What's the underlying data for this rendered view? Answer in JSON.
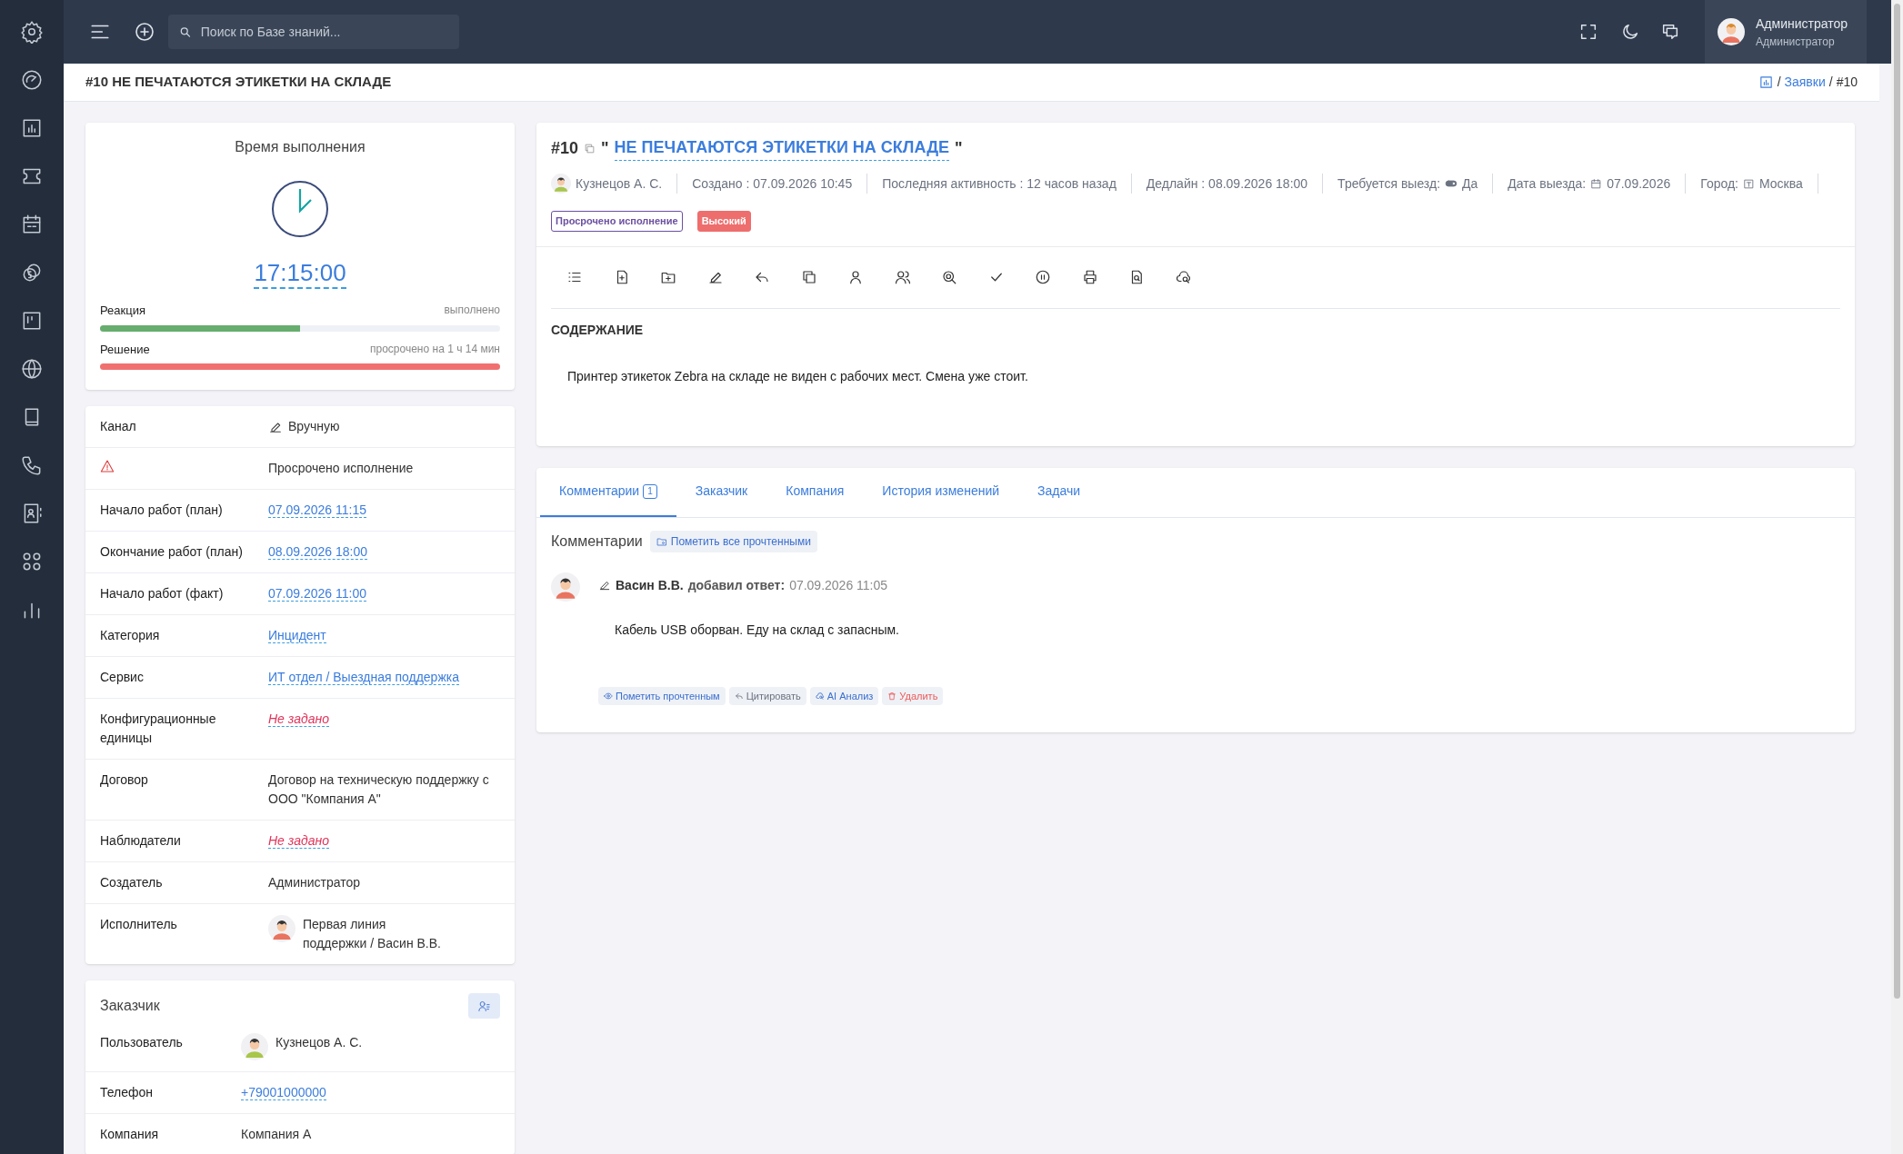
{
  "topbar": {
    "search": {
      "placeholder": "Поиск по Базе знаний..."
    },
    "user": {
      "name": "Администратор",
      "role": "Администратор"
    }
  },
  "page": {
    "title": "#10 НЕ ПЕЧАТАЮТСЯ ЭТИКЕТКИ НА СКЛАДЕ",
    "breadcrumbs": [
      {
        "kind": "separator",
        "label": "/"
      },
      {
        "kind": "link",
        "label": "Заявки"
      },
      {
        "kind": "separator",
        "label": "/"
      },
      {
        "kind": "current",
        "label": "#10"
      }
    ]
  },
  "timer": {
    "title": "Время выполнения",
    "time": "17:15:00",
    "bars": [
      {
        "label": "Реакция",
        "status": "выполнено",
        "level": 0.5,
        "color": "#66ad6e"
      },
      {
        "label": "Решение",
        "status": "просрочено на 1 ч 14 мин",
        "level": 1,
        "color": "#f07070"
      }
    ]
  },
  "details": [
    {
      "kind": "icon-text",
      "label": "Канал",
      "value": "Вручную"
    },
    {
      "kind": "warning",
      "value": "Просрочено исполнение"
    },
    {
      "kind": "link",
      "label": "Начало работ (план)",
      "value": "07.09.2026 11:15"
    },
    {
      "kind": "link",
      "label": "Окончание работ (план)",
      "value": "08.09.2026 18:00"
    },
    {
      "kind": "link",
      "label": "Начало работ (факт)",
      "value": "07.09.2026 11:00"
    },
    {
      "kind": "link",
      "label": "Категория",
      "value": "Инцидент"
    },
    {
      "kind": "link",
      "label": "Сервис",
      "value": "ИТ отдел / Выездная поддержка"
    },
    {
      "kind": "unset",
      "label": "Конфигурационные единицы",
      "value": "Не задано"
    },
    {
      "kind": "text",
      "label": "Договор",
      "value": "Договор на техническую поддержку с ООО \"Компания А\""
    },
    {
      "kind": "unset",
      "label": "Наблюдатели",
      "value": "Не задано"
    },
    {
      "kind": "text",
      "label": "Создатель",
      "value": "Администратор"
    },
    {
      "kind": "person",
      "label": "Исполнитель",
      "value": "Первая линия поддержки / Васин В.В."
    }
  ],
  "customer": {
    "title": "Заказчик",
    "rows": [
      {
        "kind": "person",
        "label": "Пользователь",
        "value": "Кузнецов А. С."
      },
      {
        "kind": "link",
        "label": "Телефон",
        "value": "+79001000000"
      },
      {
        "kind": "text",
        "label": "Компания",
        "value": "Компания А"
      }
    ]
  },
  "ticket": {
    "number": "#10",
    "open_quote": "\"",
    "title": "НЕ ПЕЧАТАЮТСЯ ЭТИКЕТКИ НА СКЛАДЕ",
    "close_quote": "\"",
    "meta": [
      {
        "kind": "person",
        "value": "Кузнецов А. С."
      },
      {
        "kind": "text",
        "value": "Создано : 07.09.2026 10:45"
      },
      {
        "kind": "text",
        "value": "Последняя активность : 12 часов назад"
      },
      {
        "kind": "text",
        "value": "Дедлайн : 08.09.2026 18:00"
      },
      {
        "kind": "toggle",
        "label": "Требуется выезд:",
        "value": "Да"
      },
      {
        "kind": "date",
        "label": "Дата выезда:",
        "value": "07.09.2026"
      },
      {
        "kind": "city",
        "label": "Город:",
        "value": "Москва"
      }
    ],
    "badges": [
      {
        "label": "Просрочено исполнение",
        "kind": "outline",
        "color": "#6b4fa0"
      },
      {
        "label": "Высокий",
        "kind": "filled",
        "color": "#ee6e6e"
      }
    ],
    "content_heading": "СОДЕРЖАНИЕ",
    "content": "Принтер этикеток Zebra на складе не виден с рабочих мест. Смена уже стоит."
  },
  "tabs": [
    {
      "label": "Комментарии",
      "count": "1",
      "selected": true
    },
    {
      "label": "Заказчик",
      "selected": false
    },
    {
      "label": "Компания",
      "selected": false
    },
    {
      "label": "История изменений",
      "selected": false
    },
    {
      "label": "Задачи",
      "selected": false
    }
  ],
  "comments": {
    "heading": "Комментарии",
    "mark_all": "Пометить все прочтенными",
    "items": [
      {
        "author": "Васин В.В.",
        "action": "добавил ответ:",
        "time": "07.09.2026 11:05",
        "text": "Кабель USB оборван. Еду на склад с запасным.",
        "actions": [
          {
            "kind": "read",
            "label": "Пометить прочтенным"
          },
          {
            "kind": "quote",
            "label": "Цитировать"
          },
          {
            "kind": "ai",
            "label": "AI Анализ"
          },
          {
            "kind": "delete",
            "label": "Удалить"
          }
        ]
      }
    ]
  }
}
